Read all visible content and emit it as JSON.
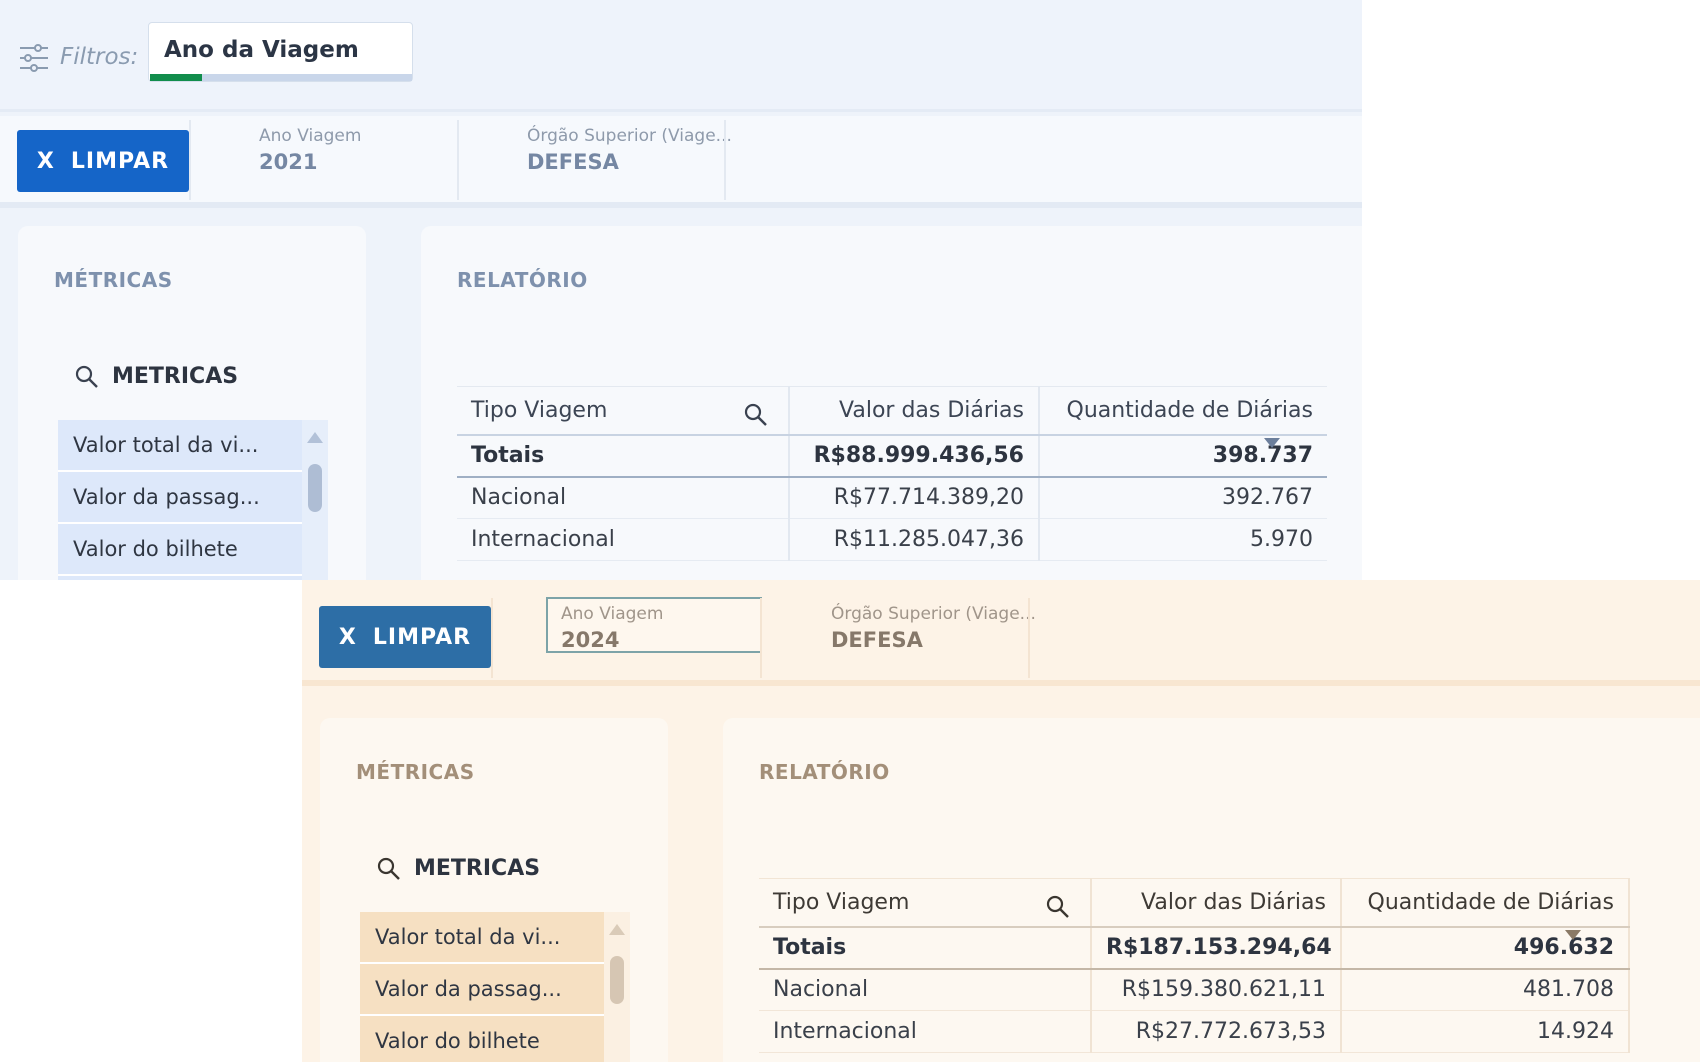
{
  "screen1": {
    "filter_bar": {
      "label": "Filtros:",
      "chip": "Ano da Viagem"
    },
    "clear_button": {
      "x": "X",
      "label": "LIMPAR"
    },
    "selections": [
      {
        "title": "Ano Viagem",
        "value": "2021"
      },
      {
        "title": "Órgão Superior (Viage...",
        "value": "DEFESA"
      }
    ],
    "metrics_panel": {
      "title": "MÉTRICAS",
      "search_label": "METRICAS",
      "items": [
        "Valor total da vi...",
        "Valor da passag...",
        "Valor do bilhete"
      ]
    },
    "report": {
      "title": "RELATÓRIO",
      "headers": [
        "Tipo Viagem",
        "Valor das Diárias",
        "Quantidade de Diárias"
      ],
      "totals": {
        "label": "Totais",
        "valor": "R$88.999.436,56",
        "quantidade": "398.737"
      },
      "rows": [
        {
          "tipo": "Nacional",
          "valor": "R$77.714.389,20",
          "quantidade": "392.767"
        },
        {
          "tipo": "Internacional",
          "valor": "R$11.285.047,36",
          "quantidade": "5.970"
        }
      ]
    }
  },
  "screen2": {
    "clear_button": {
      "x": "X",
      "label": "LIMPAR"
    },
    "selections": [
      {
        "title": "Ano Viagem",
        "value": "2024"
      },
      {
        "title": "Órgão Superior (Viage...",
        "value": "DEFESA"
      }
    ],
    "metrics_panel": {
      "title": "MÉTRICAS",
      "search_label": "METRICAS",
      "items": [
        "Valor total da vi...",
        "Valor da passag...",
        "Valor do bilhete"
      ]
    },
    "report": {
      "title": "RELATÓRIO",
      "headers": [
        "Tipo Viagem",
        "Valor das Diárias",
        "Quantidade de Diárias"
      ],
      "totals": {
        "label": "Totais",
        "valor": "R$187.153.294,64",
        "quantidade": "496.632"
      },
      "rows": [
        {
          "tipo": "Nacional",
          "valor": "R$159.380.621,11",
          "quantidade": "481.708"
        },
        {
          "tipo": "Internacional",
          "valor": "R$27.772.673,53",
          "quantidade": "14.924"
        }
      ]
    }
  },
  "colors": {
    "screen1_accent": "#1565c8",
    "screen2_accent": "#2d6ea6",
    "filter_progress": "#118d4c"
  },
  "icons": [
    "filter-sliders-icon",
    "search-icon",
    "scroll-up-icon",
    "sort-desc-icon"
  ]
}
